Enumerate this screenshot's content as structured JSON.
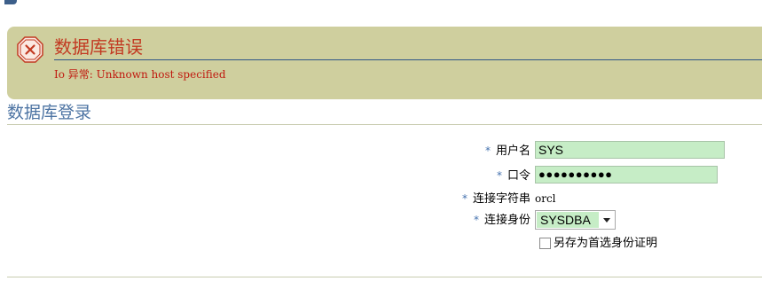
{
  "error": {
    "title": "数据库错误",
    "message": "Io 异常: Unknown host specified"
  },
  "page": {
    "title": "数据库登录"
  },
  "form": {
    "required_marker": "*",
    "username": {
      "label": "用户名",
      "value": "SYS"
    },
    "password": {
      "label": "口令",
      "masked_value": "●●●●●●●●●●"
    },
    "connect_string": {
      "label": "连接字符串",
      "value": "orcl"
    },
    "connect_as": {
      "label": "连接身份",
      "selected": "SYSDBA"
    },
    "save_preference": {
      "label": "另存为首选身份证明",
      "checked": false
    }
  },
  "colors": {
    "error_panel_bg": "#cfcf9e",
    "error_text": "#c01a10",
    "title_blue": "#4d74a3",
    "input_bg": "#c6edc6",
    "required_blue": "#4471ae"
  }
}
